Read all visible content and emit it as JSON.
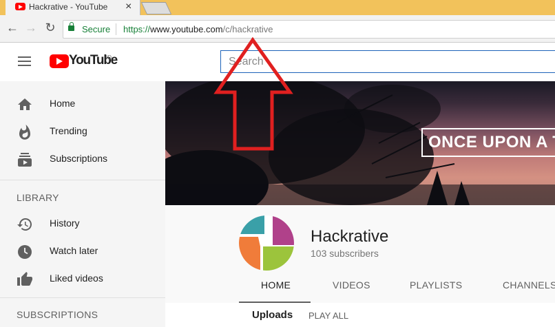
{
  "browser": {
    "tab_title": "Hackrative - YouTube",
    "tab_close": "×",
    "secure_label": "Secure",
    "url_prefix": "https://",
    "url_host": "www.youtube.com",
    "url_path": "/c/hackrative",
    "back_icon": "←",
    "forward_icon": "→",
    "reload_icon": "↻"
  },
  "header": {
    "logo_text": "YouTube",
    "region_code": "ID",
    "search_placeholder": "Search"
  },
  "sidebar": {
    "main_items": [
      {
        "label": "Home",
        "icon": "home-icon"
      },
      {
        "label": "Trending",
        "icon": "flame-icon"
      },
      {
        "label": "Subscriptions",
        "icon": "subscriptions-icon"
      }
    ],
    "library_heading": "LIBRARY",
    "library_items": [
      {
        "label": "History",
        "icon": "history-icon"
      },
      {
        "label": "Watch later",
        "icon": "clock-icon"
      },
      {
        "label": "Liked videos",
        "icon": "thumbs-up-icon"
      }
    ],
    "subscriptions_heading": "SUBSCRIPTIONS"
  },
  "channel": {
    "banner_text": "ONCE UPON A TIME",
    "name": "Hackrative",
    "subscribers": "103 subscribers",
    "tabs": [
      "HOME",
      "VIDEOS",
      "PLAYLISTS",
      "CHANNELS"
    ],
    "active_tab": "HOME",
    "section_title": "Uploads",
    "play_all": "PLAY ALL"
  },
  "colors": {
    "youtube_red": "#ff0000",
    "tab_strip": "#f2c25b",
    "secure_green": "#188038",
    "annotation_arrow": "#e02020"
  }
}
